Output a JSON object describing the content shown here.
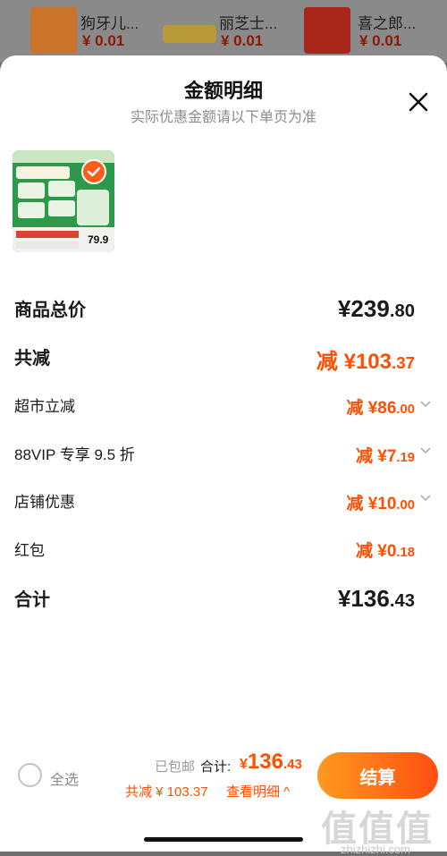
{
  "background_products": [
    {
      "name": "狗牙儿...",
      "price": "¥ 0.01"
    },
    {
      "name": "丽芝士...",
      "price": "¥ 0.01"
    },
    {
      "name": "喜之郎...",
      "price": "¥ 0.01"
    }
  ],
  "sheet": {
    "title": "金额明细",
    "subtitle": "实际优惠金额请以下单页为准",
    "product_thumb_price": "79.9"
  },
  "rows": [
    {
      "label": "商品总价",
      "prefix": "",
      "currency": "¥",
      "int": "239",
      "dec": ".80"
    },
    {
      "label": "共减",
      "prefix": "减 ",
      "currency": "¥",
      "int": "103",
      "dec": ".37"
    },
    {
      "label": "超市立减",
      "prefix": "减 ",
      "currency": "¥",
      "int": "86",
      "dec": ".00"
    },
    {
      "label": "88VIP 专享 9.5 折",
      "prefix": "减 ",
      "currency": "¥",
      "int": "7",
      "dec": ".19"
    },
    {
      "label": "店铺优惠",
      "prefix": "减 ",
      "currency": "¥",
      "int": "10",
      "dec": ".00"
    },
    {
      "label": "红包",
      "prefix": "减 ",
      "currency": "¥",
      "int": "0",
      "dec": ".18"
    },
    {
      "label": "合计",
      "prefix": "",
      "currency": "¥",
      "int": "136",
      "dec": ".43"
    }
  ],
  "bottom_bar": {
    "select_all": "全选",
    "shipping": "已包邮",
    "total_label": "合计:",
    "total_currency": "¥",
    "total_int": "136",
    "total_dec": ".43",
    "discount_summary": "共减 ¥ 103.37",
    "view_detail": "查看明细 ^",
    "checkout_label": "结算"
  },
  "watermark": {
    "text": "值值值",
    "url": "zhizhizhi.com"
  },
  "colors": {
    "accent": "#ff4f00",
    "checkout_start": "#ff9a1f",
    "checkout_end": "#ff4e12"
  }
}
